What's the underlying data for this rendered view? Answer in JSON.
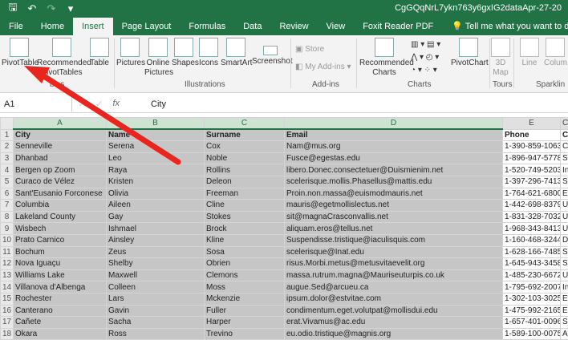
{
  "titlebar": {
    "title": "CgGQqNrL7ykn763y6gxIG2dataApr-27-20",
    "save_icon": "save-icon",
    "undo_glyph": "↶",
    "redo_glyph": "↷",
    "save_glyph": "🖫",
    "more_glyph": "▾"
  },
  "tabs": [
    "File",
    "Home",
    "Insert",
    "Page Layout",
    "Formulas",
    "Data",
    "Review",
    "View",
    "Foxit Reader PDF"
  ],
  "active_tab": "Insert",
  "tell_me": "Tell me what you want to do",
  "ribbon": {
    "pivot_table": "PivotTable",
    "recommended_pivot_1": "Recommended",
    "recommended_pivot_2": "PivotTables",
    "table": "Table",
    "tables_group": "bles",
    "pictures": "Pictures",
    "online_pictures_1": "Online",
    "online_pictures_2": "Pictures",
    "shapes": "Shapes",
    "icons": "Icons",
    "smartart": "SmartArt",
    "screenshot": "Screenshot",
    "illustrations_group": "Illustrations",
    "store": "Store",
    "my_addins": "My Add-ins",
    "addins_group": "Add-ins",
    "recommended_charts_1": "Recommended",
    "recommended_charts_2": "Charts",
    "pivot_chart": "PivotChart",
    "charts_group": "Charts",
    "map_1": "3D",
    "map_2": "Map",
    "tours_group": "Tours",
    "line": "Line",
    "column": "Colum",
    "sparklines_group": "Sparklin"
  },
  "formula_bar": {
    "name_box": "A1",
    "fx": "fx",
    "cancel": "✕",
    "enter": "✓",
    "value": "City"
  },
  "columns": [
    "A",
    "B",
    "C",
    "D",
    "E"
  ],
  "column_f": "C",
  "rows": [
    [
      "City",
      "Name",
      "Surname",
      "Email",
      "Phone"
    ],
    [
      "Senneville",
      "Serena",
      "Cox",
      "Nam@mus.org",
      "1-390-859-1063"
    ],
    [
      "Dhanbad",
      "Leo",
      "Noble",
      "Fusce@egestas.edu",
      "1-896-947-5778"
    ],
    [
      "Bergen op Zoom",
      "Raya",
      "Rollins",
      "libero.Donec.consectetuer@Duismienim.net",
      "1-520-749-5203"
    ],
    [
      "Curaco de Vélez",
      "Kristen",
      "Deleon",
      "scelerisque.mollis.Phasellus@mattis.edu",
      "1-397-296-7413"
    ],
    [
      "Sant'Eusanio Forconese",
      "Olivia",
      "Freeman",
      "Proin.non.massa@euismodmauris.net",
      "1-764-621-6800"
    ],
    [
      "Columbia",
      "Aileen",
      "Cline",
      "mauris@egetmollislectus.net",
      "1-442-698-8379"
    ],
    [
      "Lakeland County",
      "Gay",
      "Stokes",
      "sit@magnaCrasconvallis.net",
      "1-831-328-7032"
    ],
    [
      "Wisbech",
      "Ishmael",
      "Brock",
      "aliquam.eros@tellus.net",
      "1-968-343-8413"
    ],
    [
      "Prato Carnico",
      "Ainsley",
      "Kline",
      "Suspendisse.tristique@iaculisquis.com",
      "1-160-468-3244"
    ],
    [
      "Bochum",
      "Zeus",
      "Sosa",
      "scelerisque@Inat.edu",
      "1-628-166-7485"
    ],
    [
      "Nova Iguaçu",
      "Shelby",
      "Obrien",
      "risus.Morbi.metus@metusvitaevelit.org",
      "1-645-943-3458"
    ],
    [
      "Williams Lake",
      "Maxwell",
      "Clemons",
      "massa.rutrum.magna@Mauriseuturpis.co.uk",
      "1-485-230-6672"
    ],
    [
      "Villanova d'Albenga",
      "Colleen",
      "Moss",
      "augue.Sed@arcueu.ca",
      "1-795-692-2007"
    ],
    [
      "Rochester",
      "Lars",
      "Mckenzie",
      "ipsum.dolor@estvitae.com",
      "1-302-103-3025"
    ],
    [
      "Canterano",
      "Gavin",
      "Fuller",
      "condimentum.eget.volutpat@mollisdui.edu",
      "1-475-992-2165"
    ],
    [
      "Cañete",
      "Sacha",
      "Harper",
      "erat.Vivamus@ac.edu",
      "1-657-401-0096"
    ],
    [
      "Okara",
      "Ross",
      "Trevino",
      "eu.odio.tristique@magnis.org",
      "1-589-100-0075"
    ]
  ],
  "extra_col": [
    "C",
    "C",
    "Sc",
    "In",
    "Sc",
    "Et",
    "Ur",
    "Ur",
    "Ur",
    "Dr",
    "Sc",
    "Sc",
    "U",
    "In",
    "Et",
    "Et",
    "Sc",
    "A"
  ],
  "colors": {
    "accent": "#217346",
    "arrow": "#e8261f"
  }
}
